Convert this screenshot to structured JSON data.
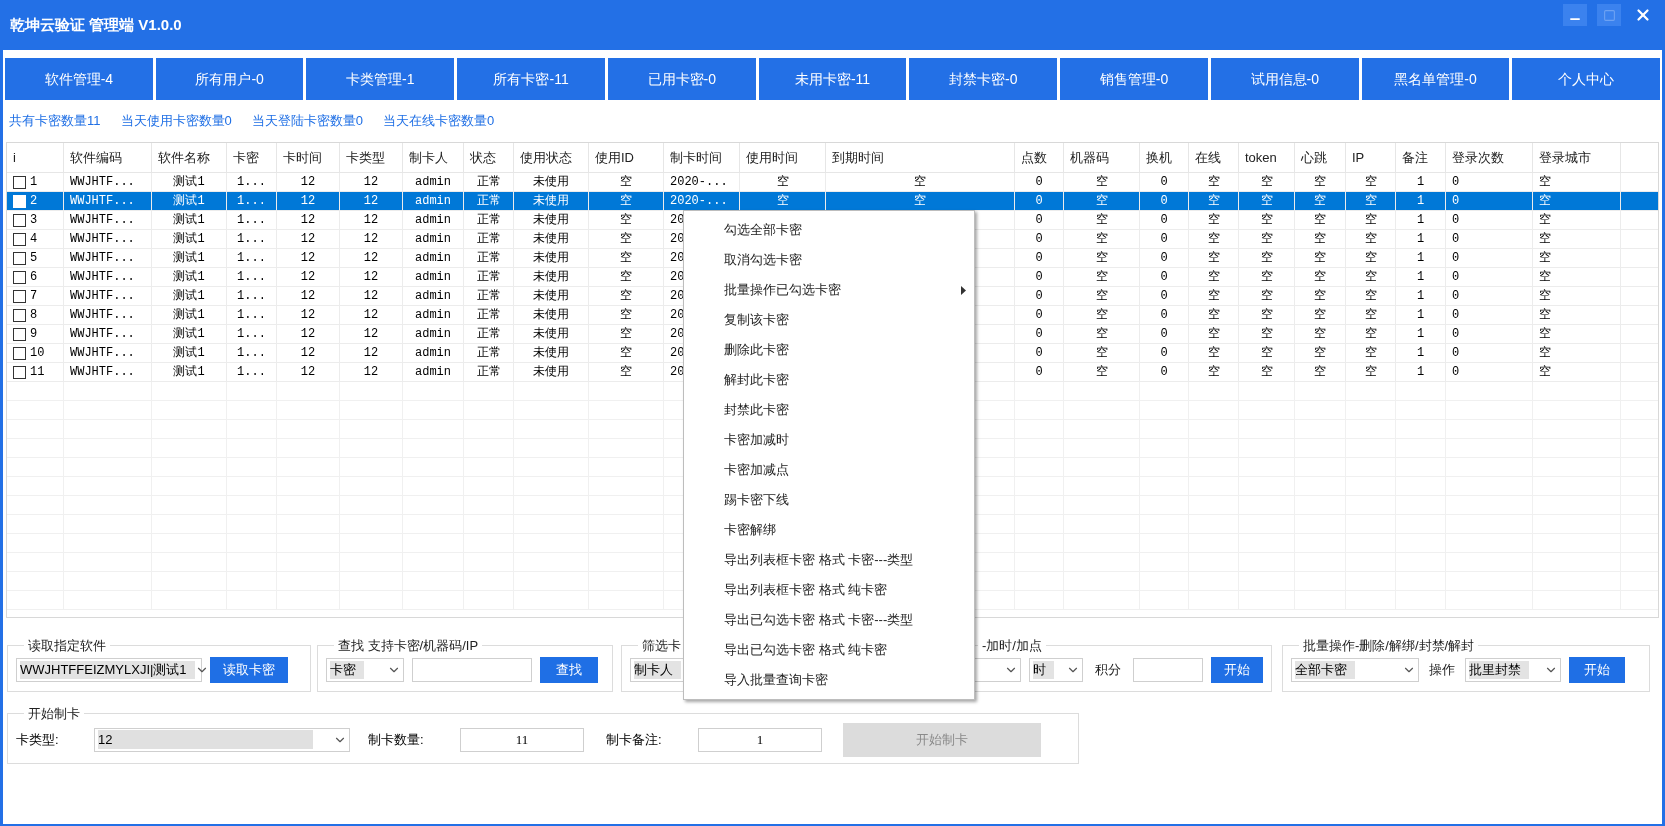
{
  "window": {
    "title": "乾坤云验证 管理端 V1.0.0"
  },
  "tabs": [
    {
      "label": "软件管理-4",
      "selected": false
    },
    {
      "label": "所有用户-0",
      "selected": false
    },
    {
      "label": "卡类管理-1",
      "selected": false
    },
    {
      "label": "所有卡密-11",
      "selected": false
    },
    {
      "label": "已用卡密-0",
      "selected": false
    },
    {
      "label": "未用卡密-11",
      "selected": false
    },
    {
      "label": "封禁卡密-0",
      "selected": false
    },
    {
      "label": "销售管理-0",
      "selected": false
    },
    {
      "label": "试用信息-0",
      "selected": false
    },
    {
      "label": "黑名单管理-0",
      "selected": false
    },
    {
      "label": "个人中心",
      "selected": false
    }
  ],
  "stats": [
    "共有卡密数量11",
    "当天使用卡密数量0",
    "当天登陆卡密数量0",
    "当天在线卡密数量0"
  ],
  "table": {
    "columns": [
      "i",
      "软件编码",
      "软件名称",
      "卡密",
      "卡时间",
      "卡类型",
      "制卡人",
      "状态",
      "使用状态",
      "使用ID",
      "制卡时间",
      "使用时间",
      "到期时间",
      "点数",
      "机器码",
      "换机",
      "在线",
      "token",
      "心跳",
      "IP",
      "备注",
      "登录次数",
      "登录城市"
    ],
    "rows": [
      {
        "selected": false,
        "checked": false,
        "cells": [
          "1",
          "WWJHTF...",
          "测试1",
          "1...",
          "12",
          "12",
          "admin",
          "正常",
          "未使用",
          "空",
          "2020-...",
          "空",
          "空",
          "0",
          "空",
          "0",
          "空",
          "空",
          "空",
          "空",
          "1",
          "0",
          "空"
        ]
      },
      {
        "selected": true,
        "checked": false,
        "cells": [
          "2",
          "WWJHTF...",
          "测试1",
          "1...",
          "12",
          "12",
          "admin",
          "正常",
          "未使用",
          "空",
          "2020-...",
          "空",
          "空",
          "0",
          "空",
          "0",
          "空",
          "空",
          "空",
          "空",
          "1",
          "0",
          "空"
        ]
      },
      {
        "selected": false,
        "checked": false,
        "cells": [
          "3",
          "WWJHTF...",
          "测试1",
          "1...",
          "12",
          "12",
          "admin",
          "正常",
          "未使用",
          "空",
          "20",
          null,
          null,
          "0",
          "空",
          "0",
          "空",
          "空",
          "空",
          "空",
          "1",
          "0",
          "空"
        ]
      },
      {
        "selected": false,
        "checked": false,
        "cells": [
          "4",
          "WWJHTF...",
          "测试1",
          "1...",
          "12",
          "12",
          "admin",
          "正常",
          "未使用",
          "空",
          "20",
          null,
          null,
          "0",
          "空",
          "0",
          "空",
          "空",
          "空",
          "空",
          "1",
          "0",
          "空"
        ]
      },
      {
        "selected": false,
        "checked": false,
        "cells": [
          "5",
          "WWJHTF...",
          "测试1",
          "1...",
          "12",
          "12",
          "admin",
          "正常",
          "未使用",
          "空",
          "20",
          null,
          null,
          "0",
          "空",
          "0",
          "空",
          "空",
          "空",
          "空",
          "1",
          "0",
          "空"
        ]
      },
      {
        "selected": false,
        "checked": false,
        "cells": [
          "6",
          "WWJHTF...",
          "测试1",
          "1...",
          "12",
          "12",
          "admin",
          "正常",
          "未使用",
          "空",
          "20",
          null,
          null,
          "0",
          "空",
          "0",
          "空",
          "空",
          "空",
          "空",
          "1",
          "0",
          "空"
        ]
      },
      {
        "selected": false,
        "checked": false,
        "cells": [
          "7",
          "WWJHTF...",
          "测试1",
          "1...",
          "12",
          "12",
          "admin",
          "正常",
          "未使用",
          "空",
          "20",
          null,
          null,
          "0",
          "空",
          "0",
          "空",
          "空",
          "空",
          "空",
          "1",
          "0",
          "空"
        ]
      },
      {
        "selected": false,
        "checked": false,
        "cells": [
          "8",
          "WWJHTF...",
          "测试1",
          "1...",
          "12",
          "12",
          "admin",
          "正常",
          "未使用",
          "空",
          "20",
          null,
          null,
          "0",
          "空",
          "0",
          "空",
          "空",
          "空",
          "空",
          "1",
          "0",
          "空"
        ]
      },
      {
        "selected": false,
        "checked": false,
        "cells": [
          "9",
          "WWJHTF...",
          "测试1",
          "1...",
          "12",
          "12",
          "admin",
          "正常",
          "未使用",
          "空",
          "20",
          null,
          null,
          "0",
          "空",
          "0",
          "空",
          "空",
          "空",
          "空",
          "1",
          "0",
          "空"
        ]
      },
      {
        "selected": false,
        "checked": false,
        "cells": [
          "10",
          "WWJHTF...",
          "测试1",
          "1...",
          "12",
          "12",
          "admin",
          "正常",
          "未使用",
          "空",
          "20",
          null,
          null,
          "0",
          "空",
          "0",
          "空",
          "空",
          "空",
          "空",
          "1",
          "0",
          "空"
        ]
      },
      {
        "selected": false,
        "checked": false,
        "cells": [
          "11",
          "WWJHTF...",
          "测试1",
          "1...",
          "12",
          "12",
          "admin",
          "正常",
          "未使用",
          "空",
          "20",
          null,
          null,
          "0",
          "空",
          "0",
          "空",
          "空",
          "空",
          "空",
          "1",
          "0",
          "空"
        ]
      }
    ]
  },
  "context_menu": [
    {
      "label": "勾选全部卡密",
      "submenu": false
    },
    {
      "label": "取消勾选卡密",
      "submenu": false
    },
    {
      "label": "批量操作已勾选卡密",
      "submenu": true
    },
    {
      "label": "复制该卡密",
      "submenu": false
    },
    {
      "label": "删除此卡密",
      "submenu": false
    },
    {
      "label": "解封此卡密",
      "submenu": false
    },
    {
      "label": "封禁此卡密",
      "submenu": false
    },
    {
      "label": "卡密加减时",
      "submenu": false
    },
    {
      "label": "卡密加减点",
      "submenu": false
    },
    {
      "label": "踢卡密下线",
      "submenu": false
    },
    {
      "label": "卡密解绑",
      "submenu": false
    },
    {
      "label": "导出列表框卡密 格式 卡密---类型",
      "submenu": false
    },
    {
      "label": "导出列表框卡密 格式 纯卡密",
      "submenu": false
    },
    {
      "label": "导出已勾选卡密 格式 卡密---类型",
      "submenu": false
    },
    {
      "label": "导出已勾选卡密 格式 纯卡密",
      "submenu": false
    },
    {
      "label": "导入批量查询卡密",
      "submenu": false
    }
  ],
  "read_software": {
    "title": "读取指定软件",
    "select": "WWJHTFFEIZMYLXJI|测试1",
    "button": "读取卡密"
  },
  "search": {
    "title": "查找 支持卡密/机器码/IP",
    "select": "卡密",
    "button": "查找"
  },
  "filter": {
    "title": "筛选卡",
    "select": "制卡人"
  },
  "add_time": {
    "title": "-加时/加点",
    "unit_select": "时",
    "points_label": "积分",
    "button": "开始"
  },
  "batch": {
    "title": "批量操作-删除/解绑/封禁/解封",
    "scope_select": "全部卡密",
    "op_label": "操作",
    "op_select": "批里封禁",
    "button": "开始"
  },
  "make_card": {
    "title": "开始制卡",
    "type_label": "卡类型:",
    "type_select": "12",
    "count_label": "制卡数量:",
    "count": "11",
    "note_label": "制卡备注:",
    "note": "1",
    "button": "开始制卡",
    "button_disabled": true
  }
}
